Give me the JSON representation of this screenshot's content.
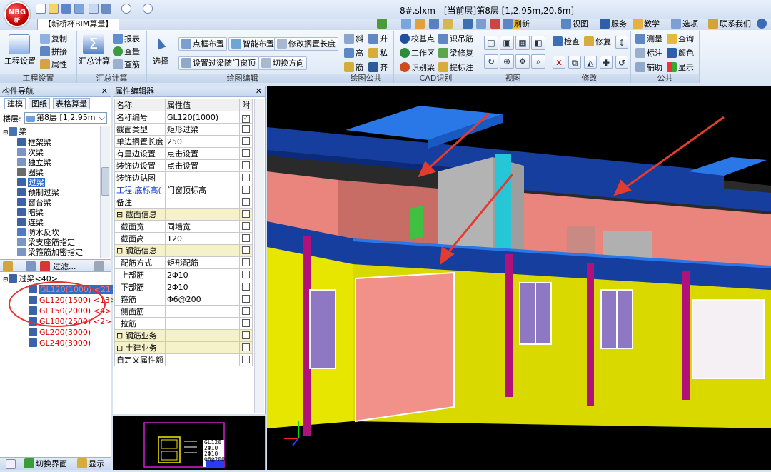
{
  "app": {
    "logo_text": "NBG",
    "logo_sub": "新",
    "window_title": "8#.slxm - [当前层]第8层 [1,2.95m,20.6m]",
    "app_tab": "【新桥杯BIM算量】"
  },
  "toolbar_right": {
    "refresh": "刷新",
    "view": "视图",
    "service": "服务",
    "teach": "教学",
    "options": "选项",
    "contact": "联系我们"
  },
  "ribbon": {
    "groups": {
      "project": "工程设置",
      "summary": "汇总计算",
      "draw_edit": "绘图编辑",
      "draw_common": "绘图公共",
      "cad": "CAD识别",
      "view": "视图",
      "modify": "修改",
      "common": "公共"
    },
    "project": {
      "big": "工程设置",
      "copy": "复制",
      "pick": "拼接",
      "attr": "属性"
    },
    "summary": {
      "big": "汇总计算",
      "report": "报表",
      "check": "查量",
      "rebar": "查筋"
    },
    "draw_edit": {
      "select": "选择",
      "point_frame": "点框布置",
      "smart": "智能布置",
      "modify_len": "修改搁置长度",
      "lintel_opening": "设置过梁随门窗顶",
      "switch_dir": "切换方向"
    },
    "draw_common": {
      "slant": "斜",
      "rise": "升",
      "high": "高",
      "private": "私",
      "rebar": "筋",
      "align": "齐"
    },
    "cad": {
      "base": "校基点",
      "identify_hang": "识吊筋",
      "work_area": "工作区",
      "beam_repair": "梁修复",
      "identify_beam": "识别梁",
      "mark": "提标注"
    },
    "modify": {
      "check": "检查",
      "repair": "修复"
    },
    "common": {
      "measure": "测量",
      "query": "查询",
      "label": "标注",
      "color": "颜色",
      "assist": "辅助",
      "display": "显示"
    }
  },
  "nav": {
    "title": "构件导航",
    "tabs": [
      "建模",
      "图纸",
      "表格算量"
    ],
    "floor_label": "楼层:",
    "floor_value": "第8层 [1,2.95m",
    "tree": [
      {
        "label": "梁",
        "level": 0
      },
      {
        "label": "框架梁",
        "level": 1
      },
      {
        "label": "次梁",
        "level": 1
      },
      {
        "label": "独立梁",
        "level": 1
      },
      {
        "label": "圈梁",
        "level": 1
      },
      {
        "label": "过梁",
        "level": 1,
        "selected": true
      },
      {
        "label": "预制过梁",
        "level": 1
      },
      {
        "label": "窗台梁",
        "level": 1
      },
      {
        "label": "暗梁",
        "level": 1
      },
      {
        "label": "连梁",
        "level": 1
      },
      {
        "label": "防水反坎",
        "level": 1
      },
      {
        "label": "梁支座筋指定",
        "level": 1
      },
      {
        "label": "梁箍筋加密指定",
        "level": 1
      }
    ],
    "filter_label": "过滤...",
    "list_root": "过梁<40>",
    "list": [
      "GL120(1000) <21>",
      "GL120(1500) <13>",
      "GL150(2000) <4>",
      "GL180(2500) <2>",
      "GL200(3000)",
      "GL240(3000)"
    ],
    "bottom": {
      "switch": "切换界面",
      "display": "显示"
    }
  },
  "props": {
    "title": "属性编辑器",
    "headers": [
      "名称",
      "属性值",
      "附"
    ],
    "rows": [
      {
        "name": "名称编号",
        "value": "GL120(1000)",
        "checked": true
      },
      {
        "name": "截面类型",
        "value": "矩形过梁"
      },
      {
        "name": "单边搁置长度",
        "value": "250"
      },
      {
        "name": "有里边设置",
        "value": "点击设置"
      },
      {
        "name": "装饰边设置",
        "value": "点击设置"
      },
      {
        "name": "装饰边贴图",
        "value": ""
      },
      {
        "name": "工程.底标高(",
        "value": "门窗顶标高",
        "blue": true
      },
      {
        "name": "备注",
        "value": ""
      },
      {
        "name": "截面信息",
        "value": "",
        "section": true
      },
      {
        "name": "截面宽",
        "value": "同墙宽",
        "indent": true
      },
      {
        "name": "截面高",
        "value": "120",
        "indent": true
      },
      {
        "name": "钢筋信息",
        "value": "",
        "section": true
      },
      {
        "name": "配筋方式",
        "value": "矩形配筋",
        "indent": true
      },
      {
        "name": "上部筋",
        "value": "2Φ10",
        "indent": true
      },
      {
        "name": "下部筋",
        "value": "2Φ10",
        "indent": true
      },
      {
        "name": "箍筋",
        "value": "Φ6@200",
        "indent": true
      },
      {
        "name": "侧面筋",
        "value": "",
        "indent": true
      },
      {
        "name": "拉筋",
        "value": "",
        "indent": true
      },
      {
        "name": "钢筋业务",
        "value": "",
        "section": true
      },
      {
        "name": "土建业务",
        "value": "",
        "section": true
      },
      {
        "name": "自定义属性额",
        "value": ""
      }
    ]
  },
  "minimap": {
    "labels": [
      "GL120",
      "2Φ10",
      "2Φ10",
      "Φ6@200"
    ]
  }
}
